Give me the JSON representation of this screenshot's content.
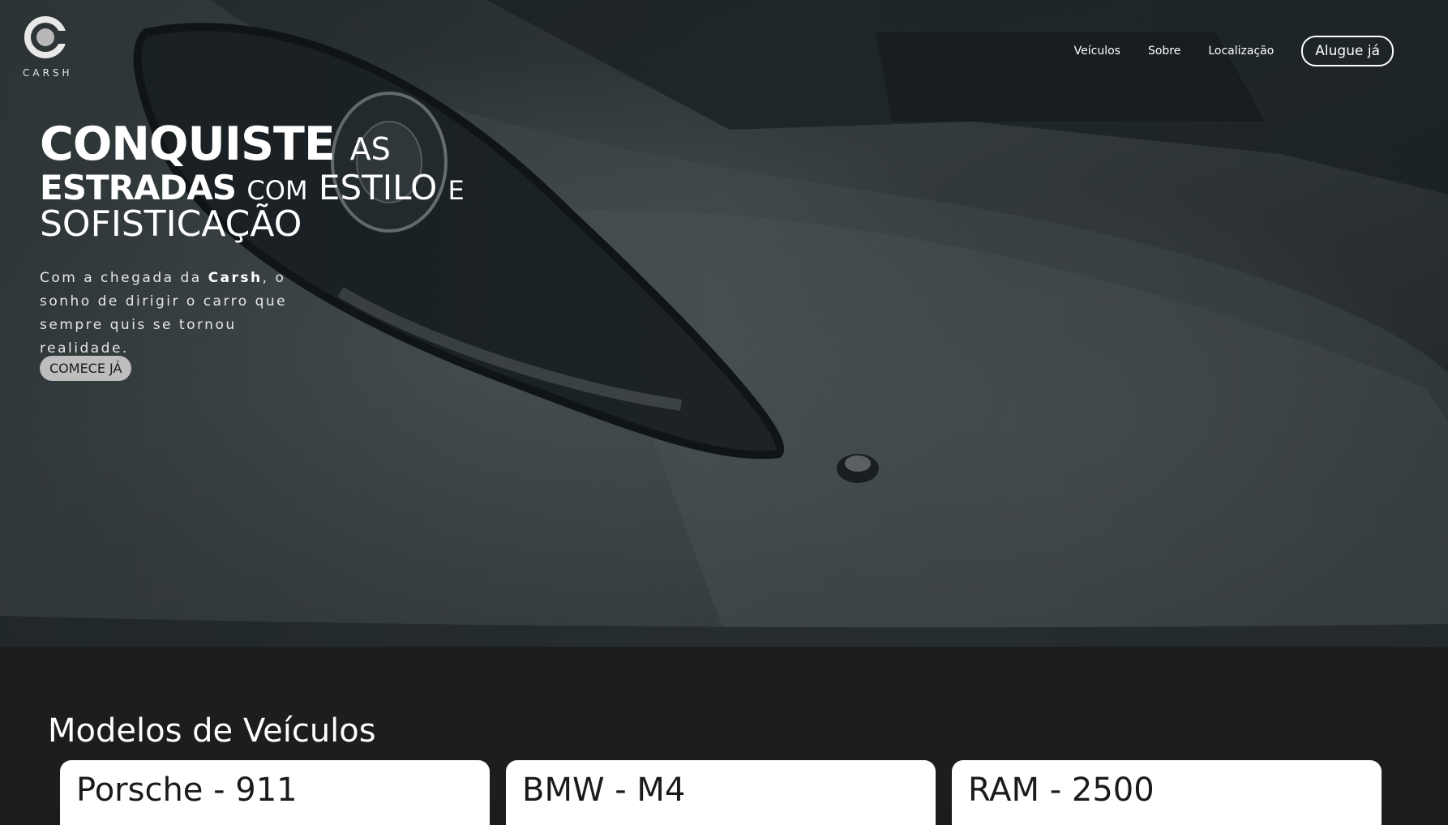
{
  "brand": {
    "name": "CARSH"
  },
  "nav": {
    "items": [
      "Veículos",
      "Sobre",
      "Localização"
    ],
    "cta": "Alugue já"
  },
  "hero": {
    "headline": {
      "w1": "CONQUISTE",
      "w2": "AS",
      "w3": "ESTRADAS",
      "w4": "COM",
      "w5": "ESTILO",
      "w6": "E",
      "w7": "SOFISTICAÇÃO"
    },
    "intro": {
      "before": "Com a chegada da ",
      "brand": "Carsh",
      "after": ", o sonho de dirigir o carro que sempre quis se tornou realidade."
    },
    "button": "COMECE JÁ"
  },
  "models": {
    "title": "Modelos de Veículos",
    "cards": [
      "Porsche - 911",
      "BMW - M4",
      "RAM - 2500"
    ]
  },
  "colors": {
    "section_bg": "#1d1d1d",
    "button_bg": "#bdbdbd",
    "card_bg": "#ffffff"
  }
}
